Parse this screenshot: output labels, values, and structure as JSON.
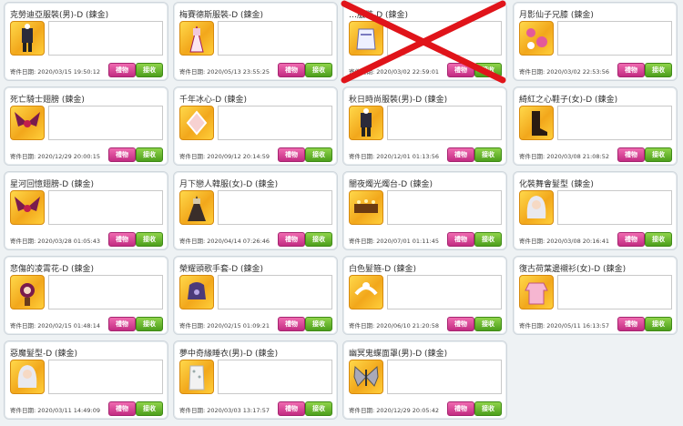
{
  "labels": {
    "date": "寄件日期:",
    "gift": "禮物",
    "receive": "接收"
  },
  "colors": {
    "gift_button": "#d23c93",
    "receive_button": "#5fae27",
    "cancel_cross": "#e0141a",
    "icon_bg": "#f6b526"
  },
  "cards": [
    {
      "title": "克勞迪亞服裝(男)-D (鍊金)",
      "date": "2020/03/15 19:50:12",
      "icon": "outfit-icon",
      "cancelled": false
    },
    {
      "title": "梅賽德斯服裝-D (鍊金)",
      "date": "2020/05/13 23:55:25",
      "icon": "dress-icon",
      "cancelled": false
    },
    {
      "title": "…服裝-D (鍊金)",
      "date": "2020/03/02 22:59:01",
      "icon": "coat-icon",
      "cancelled": true
    },
    {
      "title": "月影仙子兄膝 (鍊金)",
      "date": "2020/03/02 22:53:56",
      "icon": "ribbon-icon",
      "cancelled": false
    },
    {
      "title": "死亡騎士翅膀 (鍊金)",
      "date": "2020/12/29 20:00:15",
      "icon": "wings-icon",
      "cancelled": false
    },
    {
      "title": "千年冰心-D (鍊金)",
      "date": "2020/09/12 20:14:59",
      "icon": "ice-icon",
      "cancelled": false
    },
    {
      "title": "秋日時尚服裝(男)-D (鍊金)",
      "date": "2020/12/01 01:13:56",
      "icon": "outfit-icon",
      "cancelled": false
    },
    {
      "title": "綺紅之心鞋子(女)-D (鍊金)",
      "date": "2020/03/08 21:08:52",
      "icon": "boot-icon",
      "cancelled": false
    },
    {
      "title": "星河回憶翅膀-D (鍊金)",
      "date": "2020/03/28 01:05:43",
      "icon": "wings-icon",
      "cancelled": false
    },
    {
      "title": "月下戀人韓服(女)-D (鍊金)",
      "date": "2020/04/14 07:26:46",
      "icon": "hanbok-icon",
      "cancelled": false
    },
    {
      "title": "闇夜燭光燭台-D (鍊金)",
      "date": "2020/07/01 01:11:45",
      "icon": "candle-icon",
      "cancelled": false
    },
    {
      "title": "化裝舞會髮型 (鍊金)",
      "date": "2020/03/08 20:16:41",
      "icon": "hair-icon",
      "cancelled": false
    },
    {
      "title": "悲傷的凌霄花-D (鍊金)",
      "date": "2020/02/15 01:48:14",
      "icon": "flower-icon",
      "cancelled": false
    },
    {
      "title": "榮耀頭歌手套-D (鍊金)",
      "date": "2020/02/15 01:09:21",
      "icon": "glove-icon",
      "cancelled": false
    },
    {
      "title": "白色髮箍-D (鍊金)",
      "date": "2020/06/10 21:20:58",
      "icon": "headband-icon",
      "cancelled": false
    },
    {
      "title": "復古荷葉邊襯衫(女)-D (鍊金)",
      "date": "2020/05/11 16:13:57",
      "icon": "shirt-icon",
      "cancelled": false
    },
    {
      "title": "惡魔髮型-D (鍊金)",
      "date": "2020/03/11 14:49:09",
      "icon": "hair-icon",
      "cancelled": false
    },
    {
      "title": "夢中奇緣睡衣(男)-D (鍊金)",
      "date": "2020/03/03 13:17:57",
      "icon": "pajama-icon",
      "cancelled": false
    },
    {
      "title": "幽冥鬼蝶面罩(男)-D (鍊金)",
      "date": "2020/12/29 20:05:42",
      "icon": "butterfly-icon",
      "cancelled": false
    }
  ]
}
